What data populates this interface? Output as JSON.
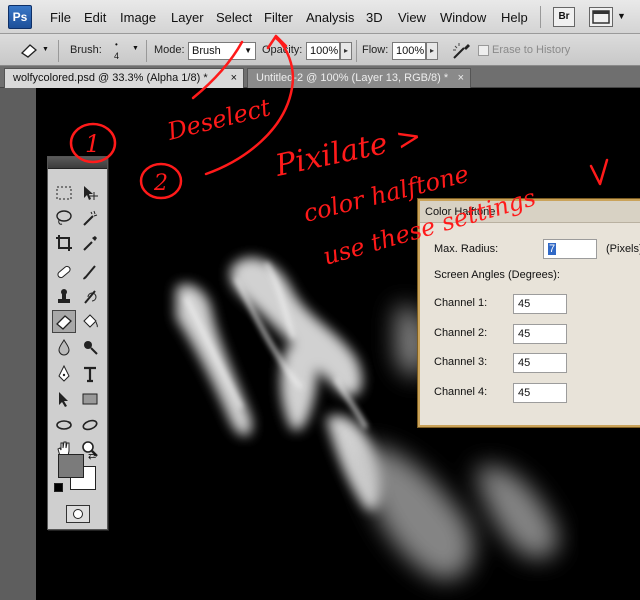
{
  "app": {
    "logo": "Ps"
  },
  "menubar": {
    "items": [
      "File",
      "Edit",
      "Image",
      "Layer",
      "Select",
      "Filter",
      "Analysis",
      "3D",
      "View",
      "Window",
      "Help"
    ],
    "bridge_label": "Br"
  },
  "options": {
    "brush_label": "Brush:",
    "brush_size": "4",
    "mode_label": "Mode:",
    "mode_value": "Brush",
    "opacity_label": "Opacity:",
    "opacity_value": "100%",
    "flow_label": "Flow:",
    "flow_value": "100%",
    "erase_history_label": "Erase to History"
  },
  "tabs": [
    {
      "label": "wolfycolored.psd @ 33.3% (Alpha 1/8) *",
      "close": "×"
    },
    {
      "label": "Untitled-2 @ 100% (Layer 13, RGB/8) *",
      "close": "×"
    }
  ],
  "dialog": {
    "title": "Color Halftone",
    "max_radius_label": "Max. Radius:",
    "max_radius_value": "7",
    "pixels_label": "(Pixels)",
    "screen_angles_label": "Screen Angles (Degrees):",
    "channels": [
      {
        "label": "Channel 1:",
        "value": "45"
      },
      {
        "label": "Channel 2:",
        "value": "45"
      },
      {
        "label": "Channel 3:",
        "value": "45"
      },
      {
        "label": "Channel 4:",
        "value": "45"
      }
    ]
  },
  "annotations": {
    "step1": "1",
    "step2": "2",
    "deselect": "Deselect",
    "line1": "Pixilate >",
    "line2": "color halftone",
    "line3": "use these settings",
    "color": "#ff1a1a"
  }
}
